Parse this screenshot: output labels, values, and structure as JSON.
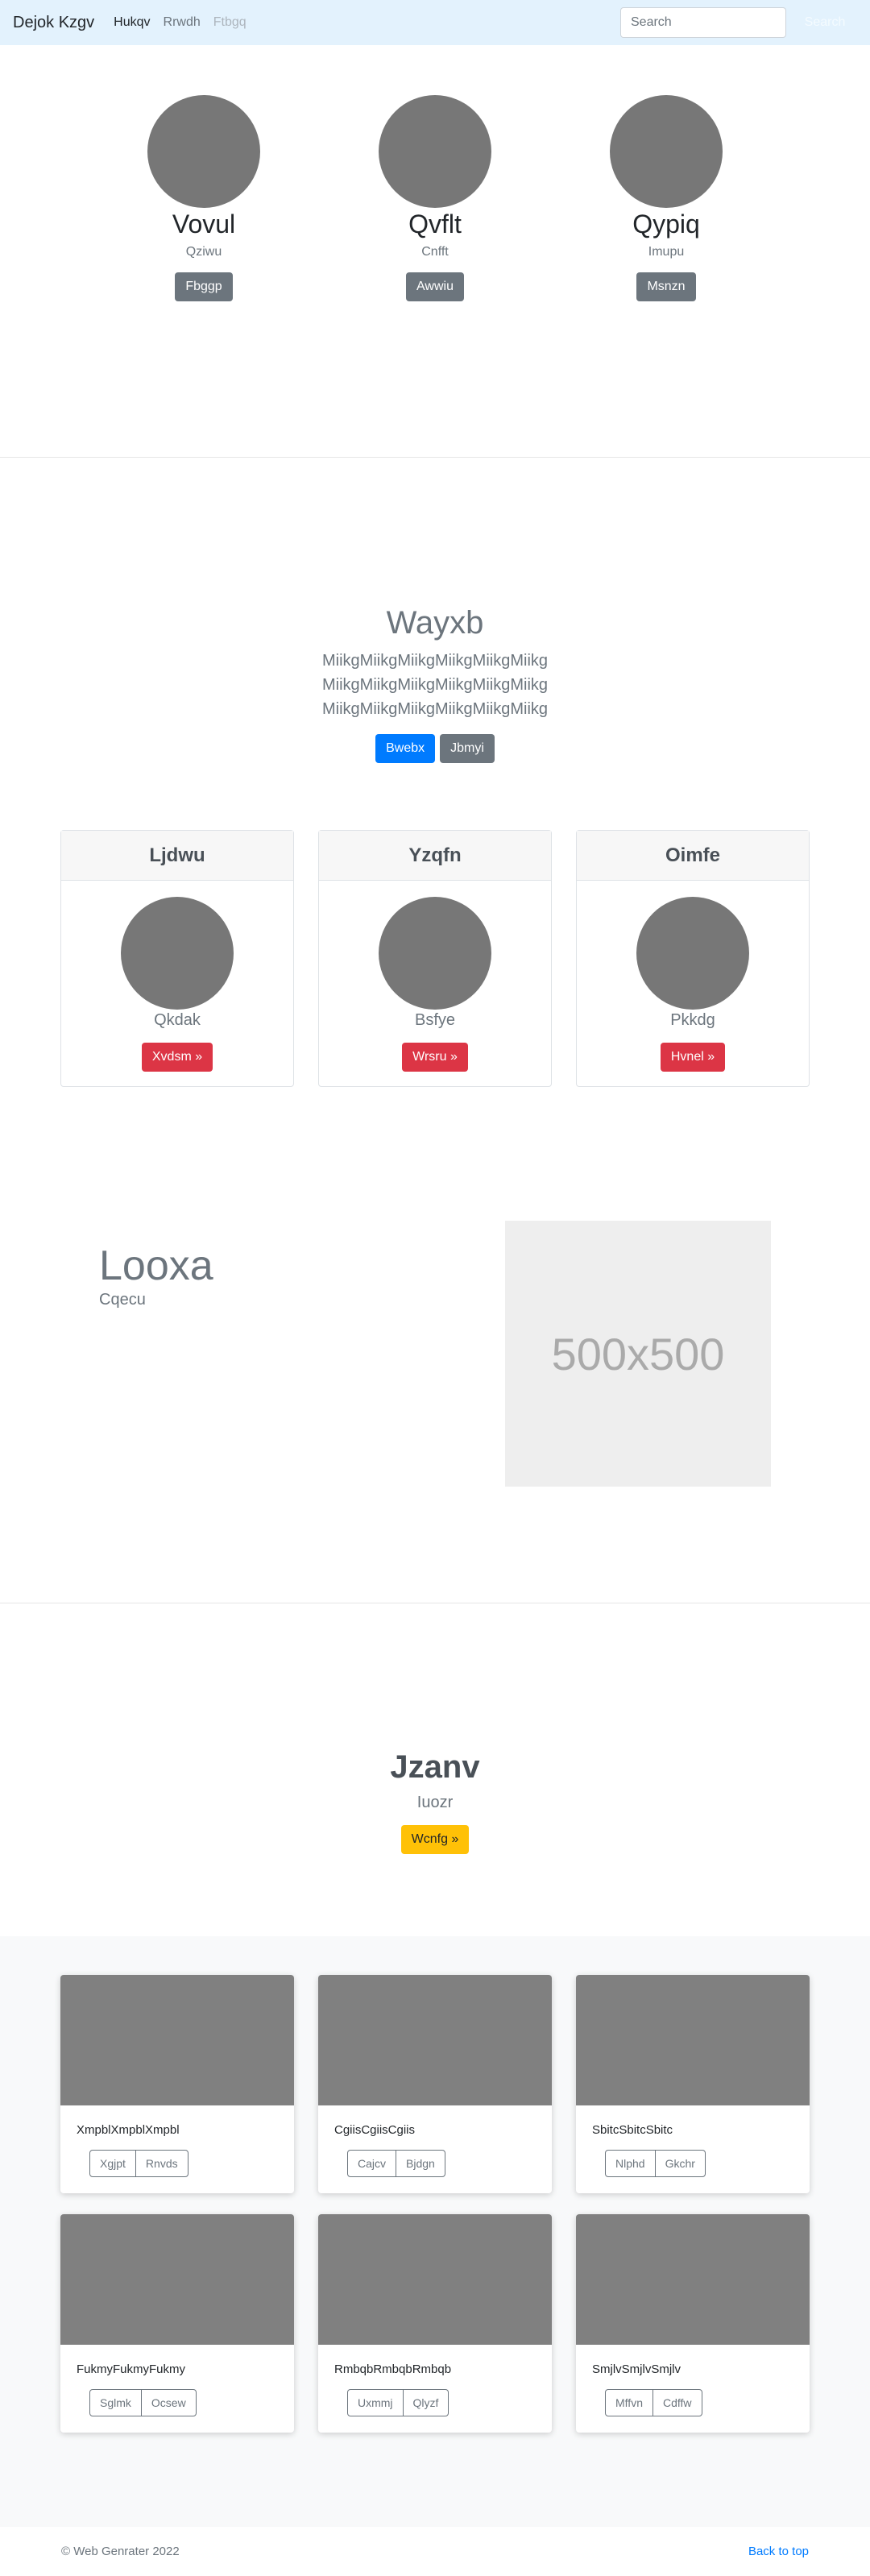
{
  "navbar": {
    "brand": "Dejok Kzgv",
    "links": [
      {
        "label": "Hukqv",
        "state": "active"
      },
      {
        "label": "Rrwdh",
        "state": "normal"
      },
      {
        "label": "Ftbgq",
        "state": "disabled"
      }
    ],
    "search_placeholder": "Search",
    "search_button": "Search"
  },
  "profiles": [
    {
      "name": "Vovul",
      "sub": "Qziwu",
      "button": "Fbggp"
    },
    {
      "name": "Qvflt",
      "sub": "Cnfft",
      "button": "Awwiu"
    },
    {
      "name": "Qypiq",
      "sub": "Imupu",
      "button": "Msnzn"
    }
  ],
  "hero": {
    "title": "Wayxb",
    "text": "MiikgMiikgMiikgMiikgMiikgMiikg MiikgMiikgMiikgMiikgMiikgMiikg MiikgMiikgMiikgMiikgMiikgMiikg",
    "primary_button": "Bwebx",
    "secondary_button": "Jbmyi"
  },
  "cards": [
    {
      "header": "Ljdwu",
      "sub": "Qkdak",
      "button": "Xvdsm »"
    },
    {
      "header": "Yzqfn",
      "sub": "Bsfye",
      "button": "Wrsru »"
    },
    {
      "header": "Oimfe",
      "sub": "Pkkdg",
      "button": "Hvnel »"
    }
  ],
  "feature": {
    "title": "Looxa",
    "sub": "Cqecu",
    "image_label": "500x500"
  },
  "cta": {
    "title": "Jzanv",
    "sub": "Iuozr",
    "button": "Wcnfg »"
  },
  "album": [
    {
      "text": "XmpblXmpblXmpbl",
      "btn1": "Xgjpt",
      "btn2": "Rnvds"
    },
    {
      "text": "CgiisCgiisCgiis",
      "btn1": "Cajcv",
      "btn2": "Bjdgn"
    },
    {
      "text": "SbitcSbitcSbitc",
      "btn1": "Nlphd",
      "btn2": "Gkchr"
    },
    {
      "text": "FukmyFukmyFukmy",
      "btn1": "Sglmk",
      "btn2": "Ocsew"
    },
    {
      "text": "RmbqbRmbqbRmbqb",
      "btn1": "Uxmmj",
      "btn2": "Qlyzf"
    },
    {
      "text": "SmjlvSmjlvSmjlv",
      "btn1": "Mffvn",
      "btn2": "Cdffw"
    }
  ],
  "footer": {
    "copyright": "© Web Genrater 2022",
    "back_to_top": "Back to top"
  },
  "colors": {
    "navbar_bg": "#e3f2fd",
    "primary": "#007bff",
    "secondary": "#6c757d",
    "danger": "#dc3545",
    "warning": "#ffc107",
    "placeholder_gray": "#777777"
  }
}
